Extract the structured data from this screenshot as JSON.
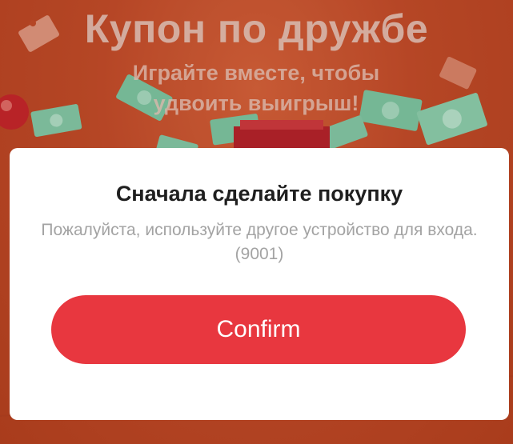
{
  "banner": {
    "title": "Купон по дружбе",
    "subtitle": "Играйте вместе, чтобы удвоить выигрыш!"
  },
  "dialog": {
    "title": "Сначала сделайте покупку",
    "message": "Пожалуйста, используйте другое устройство для входа. (9001)",
    "confirm_label": "Confirm"
  },
  "decorations": {
    "icons": [
      "banknote-icon",
      "coupon-ticket-icon",
      "red-ball-icon",
      "gift-box-icon"
    ]
  },
  "colors": {
    "background": "#c24a28",
    "confirm_button": "#e8373f",
    "title_text": "#1f1f1f",
    "message_text": "#a3a3a3"
  }
}
